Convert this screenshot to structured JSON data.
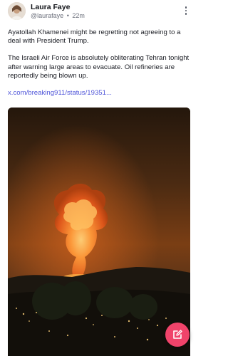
{
  "post": {
    "author": {
      "name": "Laura Faye",
      "handle": "@laurafaye",
      "separator": "•",
      "time_ago": "22m"
    },
    "body": {
      "paragraphs": [
        "Ayatollah Khamenei might be regretting not agreeing to a deal with President Trump.",
        "The Israeli Air Force is absolutely obliterating Tehran tonight after warning large areas to evacuate. Oil refineries are reportedly being blown up."
      ],
      "link_text": "x.com/breaking911/status/19351..."
    },
    "icons": {
      "more": "more-vertical-icon",
      "compose": "edit-icon"
    },
    "colors": {
      "link": "#4f55d9",
      "fab": "#f0436a"
    }
  }
}
